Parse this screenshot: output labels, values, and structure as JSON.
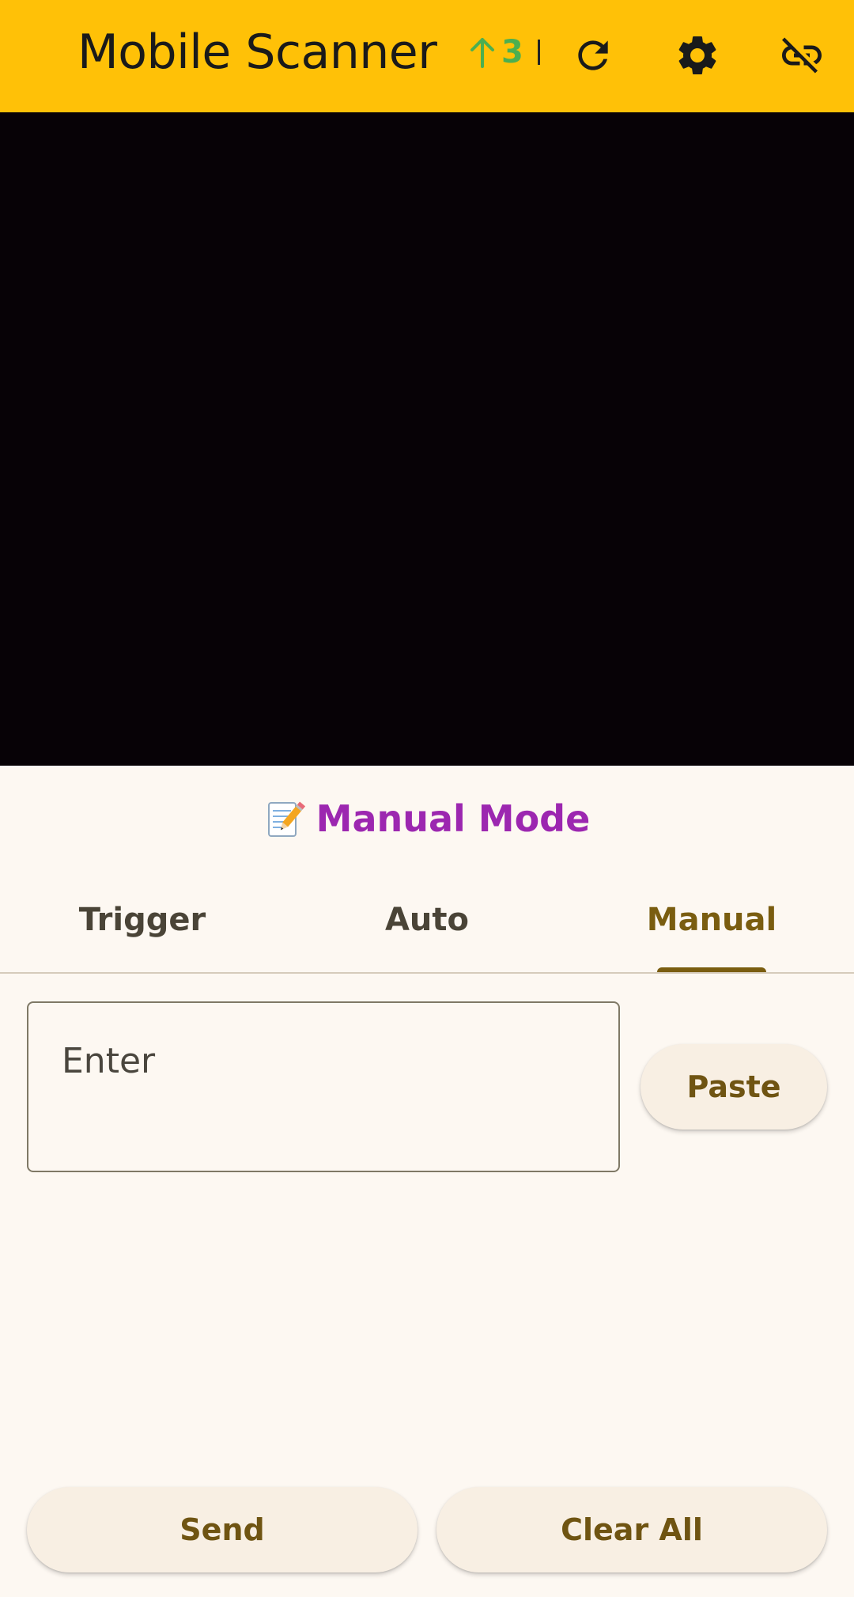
{
  "app_bar": {
    "title": "Mobile Scanner",
    "upload_count": "3",
    "icons": [
      "arrow-upward-icon",
      "refresh-icon",
      "settings-icon",
      "link-off-icon"
    ],
    "colors": {
      "background": "#FFC107",
      "upload_status": "#4CAF50"
    }
  },
  "camera": {
    "background": "#070206"
  },
  "mode": {
    "title": "Manual Mode",
    "emoji_icon": "memo-pencil-icon",
    "color": "#9C27B0"
  },
  "tabs": [
    {
      "label": "Trigger",
      "active": false
    },
    {
      "label": "Auto",
      "active": false
    },
    {
      "label": "Manual",
      "active": true
    }
  ],
  "input": {
    "placeholder": "Enter",
    "value": ""
  },
  "buttons": {
    "paste": "Paste",
    "send": "Send",
    "clear_all": "Clear All"
  }
}
